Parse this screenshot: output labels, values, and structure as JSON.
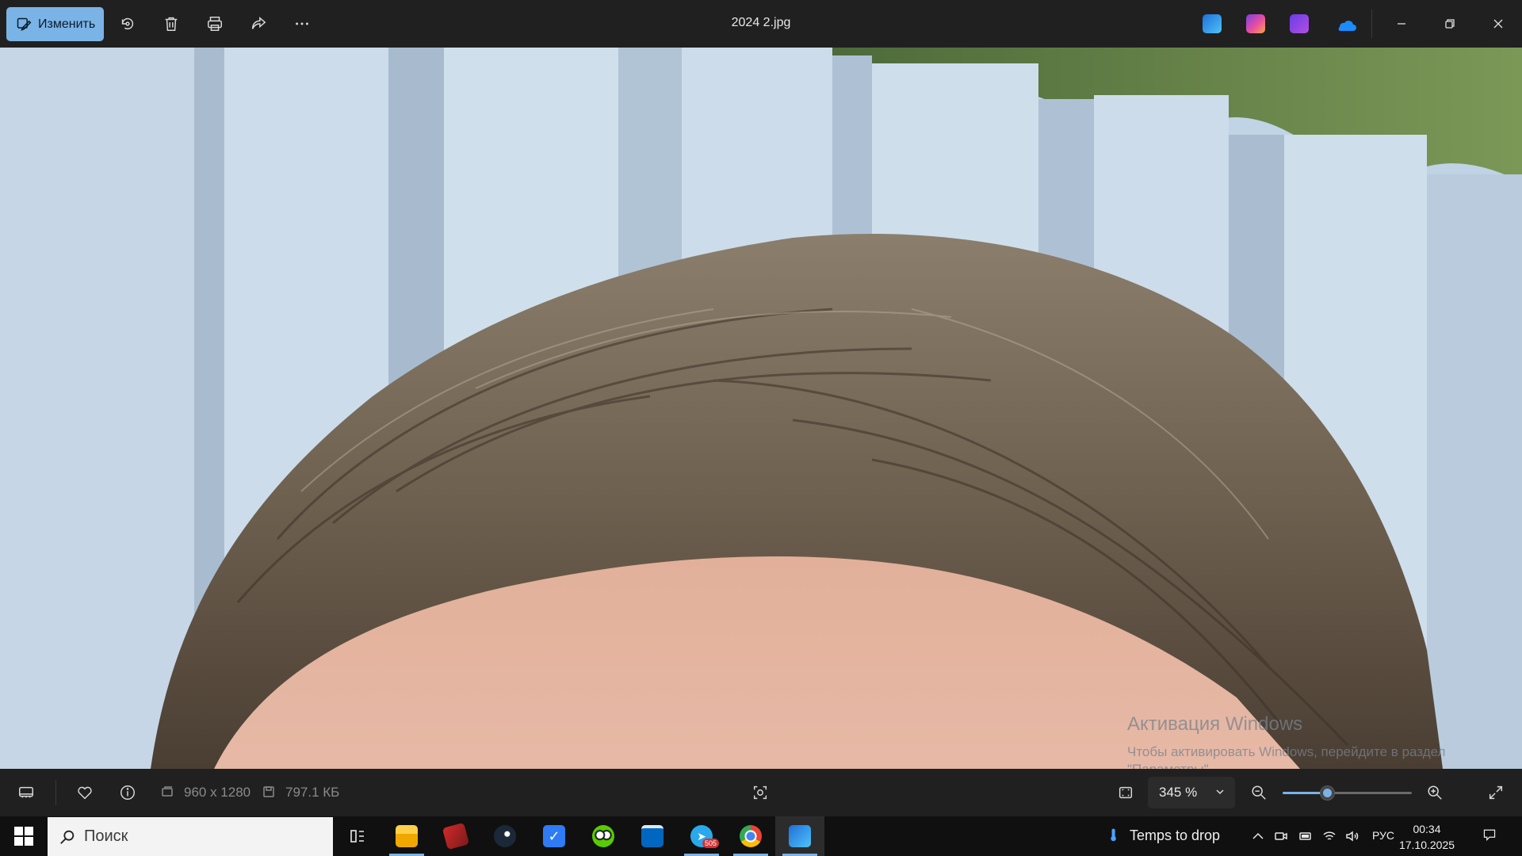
{
  "toolbar": {
    "edit_label": "Изменить",
    "file_title": "2024 2.jpg",
    "icons": [
      "edit-icon",
      "rotate-icon",
      "delete-icon",
      "print-icon",
      "share-icon",
      "more-icon"
    ],
    "app_icons": [
      "photos-app-icon",
      "copilot-icon",
      "clipchamp-icon",
      "onedrive-icon"
    ],
    "window_controls": [
      "minimize",
      "restore",
      "close"
    ]
  },
  "photo": {
    "description_icon": "photo-viewer-image",
    "watermark_title": "Активация Windows",
    "watermark_line1": "Чтобы активировать Windows, перейдите в раздел",
    "watermark_line2": "\"Параметры\"."
  },
  "infobar": {
    "dimensions": "960 x 1280",
    "file_size": "797.1 КБ",
    "zoom_value": "345 %",
    "zoom_fraction": 0.35
  },
  "taskbar": {
    "search_placeholder": "Поиск",
    "apps": [
      "task-view",
      "file-explorer",
      "winrar",
      "steam",
      "todo",
      "duolingo",
      "store",
      "telegram",
      "chrome",
      "photos"
    ],
    "telegram_badge": "505",
    "weather_text": "Temps to drop",
    "language": "РУС",
    "time": "00:34",
    "date": "17.10.2025"
  },
  "colors": {
    "accent": "#7ab3e6",
    "toolbar_bg": "#202020",
    "taskbar_bg": "#101010"
  }
}
